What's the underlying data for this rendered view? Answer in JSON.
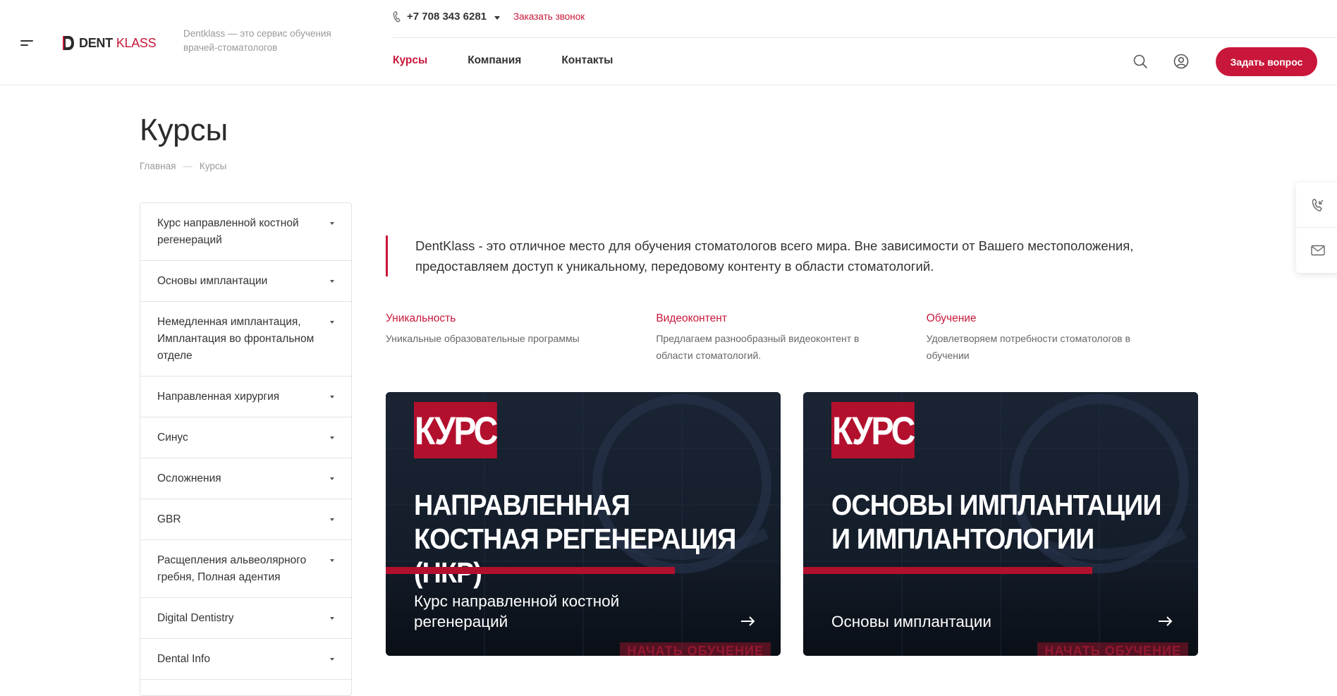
{
  "header": {
    "logo": {
      "dent": "DENT",
      "klass": "KLASS"
    },
    "slogan": "Dentklass — это сервис обучения врачей-стоматологов",
    "phone": "+7 708 343 6281",
    "callback_label": "Заказать звонок",
    "nav": [
      {
        "label": "Курсы",
        "active": true
      },
      {
        "label": "Компания",
        "active": false
      },
      {
        "label": "Контакты",
        "active": false
      }
    ],
    "ask_button": "Задать вопрос",
    "accent_color": "#c8173a"
  },
  "page": {
    "title": "Курсы",
    "breadcrumb": [
      "Главная",
      "—",
      "Курсы"
    ]
  },
  "sidebar": {
    "items": [
      {
        "label": "Курс направленной костной регенераций"
      },
      {
        "label": "Основы имплантации"
      },
      {
        "label": "Немедленная имплантация, Имплантация во фронтальном отделе"
      },
      {
        "label": "Направленная хирургия"
      },
      {
        "label": "Синус"
      },
      {
        "label": "Осложнения"
      },
      {
        "label": "GBR"
      },
      {
        "label": "Расщепления альвеолярного гребня, Полная адентия"
      },
      {
        "label": "Digital Dentistry"
      },
      {
        "label": "Dental Info"
      }
    ]
  },
  "intro": "DentKlass - это отличное место для обучения стоматологов всего мира. Вне зависимости от Вашего местоположения, предоставляем доступ к уникальному, передовому контенту в области стоматологий.",
  "features": [
    {
      "title": "Уникальность",
      "text": "Уникальные образовательные программы"
    },
    {
      "title": "Видеоконтент",
      "text": "Предлагаем разнообразный видеоконтент в области стоматологий."
    },
    {
      "title": "Обучение",
      "text": "Удовлетворяем потребности стоматологов в обучении"
    }
  ],
  "cards": [
    {
      "badge": "КУРС",
      "headline": "НАПРАВЛЕННАЯ КОСТНАЯ РЕГЕНЕРАЦИЯ (НКР)",
      "name": "Курс направленной костной регенераций",
      "watermark": "НАЧАТЬ ОБУЧЕНИЕ"
    },
    {
      "badge": "КУРС",
      "headline": "ОСНОВЫ ИМПЛАНТАЦИИ И ИМПЛАНТОЛОГИИ",
      "name": "Основы имплантации",
      "watermark": "НАЧАТЬ ОБУЧЕНИЕ"
    }
  ]
}
